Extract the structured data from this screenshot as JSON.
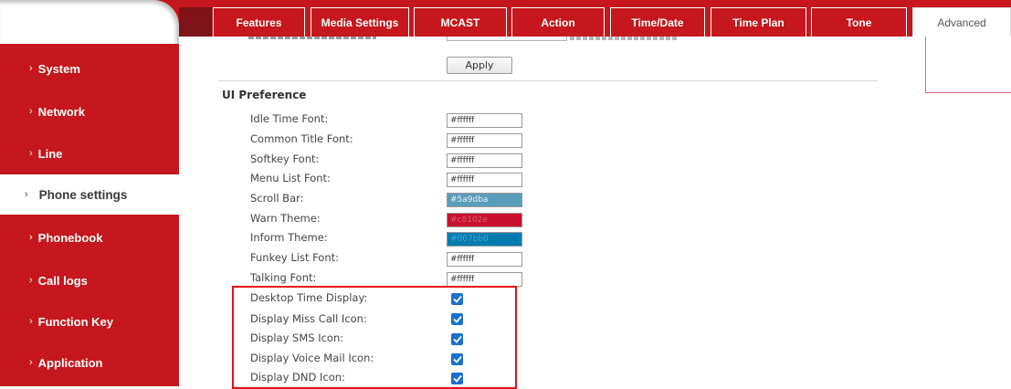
{
  "tabs": [
    {
      "label": "Features"
    },
    {
      "label": "Media Settings"
    },
    {
      "label": "MCAST"
    },
    {
      "label": "Action"
    },
    {
      "label": "Time/Date"
    },
    {
      "label": "Time Plan"
    },
    {
      "label": "Tone"
    },
    {
      "label": "Advanced"
    }
  ],
  "active_tab": "Advanced",
  "sidebar": {
    "chevron": "›",
    "items": [
      {
        "label": "System"
      },
      {
        "label": "Network"
      },
      {
        "label": "Line"
      },
      {
        "label": "Phone settings"
      },
      {
        "label": "Phonebook"
      },
      {
        "label": "Call logs"
      },
      {
        "label": "Function Key"
      },
      {
        "label": "Application"
      }
    ],
    "active": "Phone settings"
  },
  "top_section": {
    "apply_label": "Apply"
  },
  "ui_preference": {
    "title": "UI Preference",
    "colors": [
      {
        "label": "Idle Time Font:",
        "value": "#ffffff",
        "bg": "#ffffff"
      },
      {
        "label": "Common Title Font:",
        "value": "#ffffff",
        "bg": "#ffffff"
      },
      {
        "label": "Softkey Font:",
        "value": "#ffffff",
        "bg": "#ffffff"
      },
      {
        "label": "Menu List Font:",
        "value": "#ffffff",
        "bg": "#ffffff"
      },
      {
        "label": "Scroll Bar:",
        "value": "#5a9dba",
        "bg": "#5a9dba"
      },
      {
        "label": "Warn Theme:",
        "value": "#c8102e",
        "bg": "#c8102e"
      },
      {
        "label": "Inform Theme:",
        "value": "#007bb0",
        "bg": "#007bb0"
      },
      {
        "label": "Funkey List Font:",
        "value": "#ffffff",
        "bg": "#ffffff"
      },
      {
        "label": "Talking Font:",
        "value": "#ffffff",
        "bg": "#ffffff"
      }
    ],
    "display_options": [
      {
        "label": "Desktop Time Display:",
        "checked": true
      },
      {
        "label": "Display Miss Call Icon:",
        "checked": true
      },
      {
        "label": "Display SMS Icon:",
        "checked": true
      },
      {
        "label": "Display Voice Mail Icon:",
        "checked": true
      },
      {
        "label": "Display DND Icon:",
        "checked": true
      }
    ]
  },
  "theme": {
    "brand_red": "#c5171d",
    "highlight_red": "#e3101b",
    "checkbox_blue": "#1a6fd1"
  }
}
